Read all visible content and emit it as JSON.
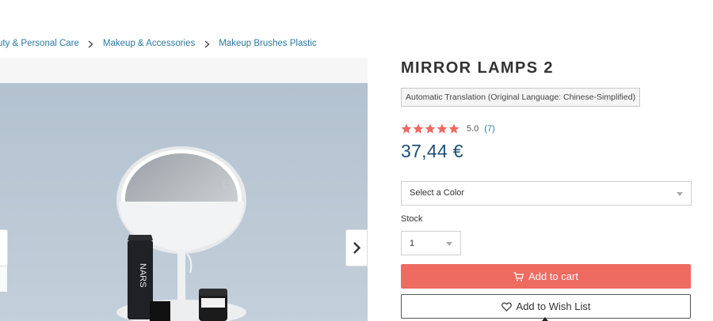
{
  "breadcrumb": {
    "items": [
      {
        "label": "uty & Personal Care"
      },
      {
        "label": "Makeup & Accessories"
      },
      {
        "label": "Makeup Brushes Plastic"
      }
    ]
  },
  "product": {
    "title": "MIRROR LAMPS 2",
    "translation_note": "Automatic Translation (Original Language: Chinese-Simplified)",
    "rating": {
      "stars_filled": 5,
      "stars_total": 5,
      "value": "5.0",
      "count": "(7)",
      "star_color": "#ee6b61"
    },
    "price": "37,44 €",
    "image": {
      "alt": "mirror lamp on stand with cosmetics",
      "background_color": "#b9c7d4",
      "tube_label": "NARS"
    }
  },
  "options": {
    "color_select": {
      "value": "Select a Color"
    },
    "stock_label": "Stock",
    "quantity_select": {
      "value": "1"
    }
  },
  "actions": {
    "add_to_cart": "Add to cart",
    "add_to_wishlist": "Add to Wish List",
    "cart_color": "#ee6b61"
  },
  "icons": {
    "breadcrumb_separator": "chevron-right-icon",
    "gallery_next": "chevron-right-icon",
    "cart": "cart-icon",
    "wishlist": "heart-icon",
    "select_caret": "caret-down-icon"
  }
}
